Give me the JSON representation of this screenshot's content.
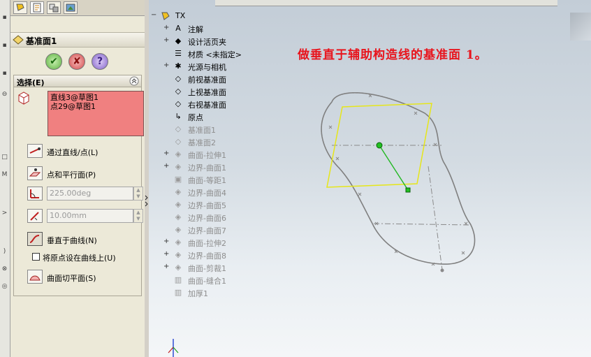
{
  "panel": {
    "title": "基准面1",
    "selection_group": {
      "title": "选择(E)",
      "selections": [
        "直线3@草图1",
        "点29@草图1"
      ]
    },
    "options": [
      {
        "label": "通过直线/点(L)",
        "selected": false
      },
      {
        "label": "点和平行面(P)",
        "selected": false
      },
      {
        "label": "垂直于曲线(N)",
        "selected": true
      },
      {
        "label": "曲面切平面(S)",
        "selected": false
      }
    ],
    "angle_value": "225.00deg",
    "distance_value": "10.00mm",
    "checkbox_label": "将原点设在曲线上(U)",
    "checkbox_checked": false,
    "ok_icon": "check-icon",
    "cancel_icon": "cross-icon",
    "help_icon": "question-icon",
    "help_glyph": "?"
  },
  "tree": {
    "root": "TX",
    "items": [
      {
        "label": "注解",
        "expand": "+",
        "icon": "A",
        "dim": false
      },
      {
        "label": "设计活页夹",
        "expand": "+",
        "icon": "◆",
        "dim": false
      },
      {
        "label": "材质 <未指定>",
        "expand": "",
        "icon": "☰",
        "dim": false
      },
      {
        "label": "光源与相机",
        "expand": "+",
        "icon": "✱",
        "dim": false
      },
      {
        "label": "前视基准面",
        "expand": "",
        "icon": "◇",
        "dim": false
      },
      {
        "label": "上视基准面",
        "expand": "",
        "icon": "◇",
        "dim": false
      },
      {
        "label": "右视基准面",
        "expand": "",
        "icon": "◇",
        "dim": false
      },
      {
        "label": "原点",
        "expand": "",
        "icon": "↳",
        "dim": false
      },
      {
        "label": "基准面1",
        "expand": "",
        "icon": "◇",
        "dim": true
      },
      {
        "label": "基准面2",
        "expand": "",
        "icon": "◇",
        "dim": true
      },
      {
        "label": "曲面-拉伸1",
        "expand": "+",
        "icon": "◈",
        "dim": true
      },
      {
        "label": "边界-曲面1",
        "expand": "+",
        "icon": "◈",
        "dim": true
      },
      {
        "label": "曲面-等距1",
        "expand": "",
        "icon": "▣",
        "dim": true
      },
      {
        "label": "边界-曲面4",
        "expand": "",
        "icon": "◈",
        "dim": true
      },
      {
        "label": "边界-曲面5",
        "expand": "",
        "icon": "◈",
        "dim": true
      },
      {
        "label": "边界-曲面6",
        "expand": "",
        "icon": "◈",
        "dim": true
      },
      {
        "label": "边界-曲面7",
        "expand": "",
        "icon": "◈",
        "dim": true
      },
      {
        "label": "曲面-拉伸2",
        "expand": "+",
        "icon": "◈",
        "dim": true
      },
      {
        "label": "边界-曲面8",
        "expand": "+",
        "icon": "◈",
        "dim": true
      },
      {
        "label": "曲面-剪裁1",
        "expand": "+",
        "icon": "◈",
        "dim": true
      },
      {
        "label": "曲面-缝合1",
        "expand": "",
        "icon": "▥",
        "dim": true
      },
      {
        "label": "加厚1",
        "expand": "",
        "icon": "▥",
        "dim": true
      }
    ]
  },
  "annotation": "做垂直于辅助构造线的基准面 1。",
  "colors": {
    "selection_bg": "#f08080",
    "annotation": "#e8141c",
    "plane_outline": "#e6e619",
    "normal_line": "#22b822",
    "sketch": "#7f7f7f"
  }
}
